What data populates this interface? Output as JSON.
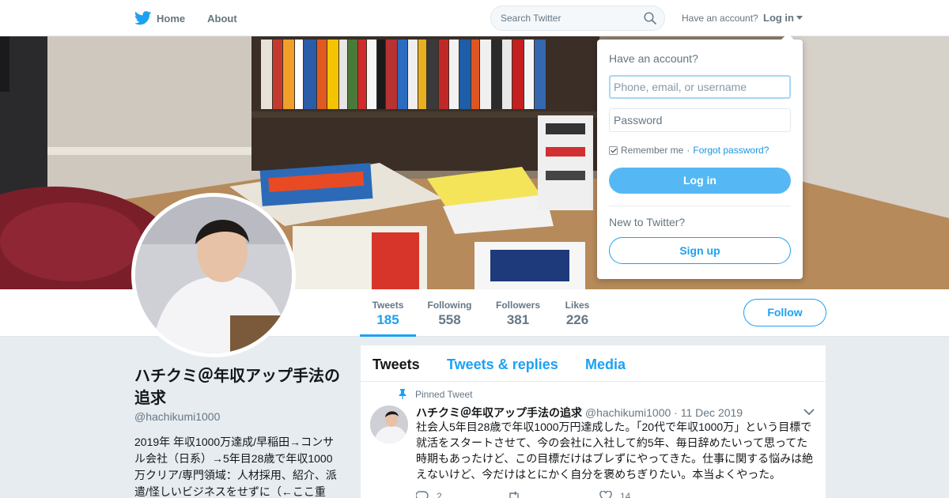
{
  "nav": {
    "home_label": "Home",
    "about_label": "About",
    "search_placeholder": "Search Twitter",
    "have_account": "Have an account?",
    "login_label": "Log in"
  },
  "profile": {
    "name": "ハチクミ＠年収アップ手法の追求",
    "handle": "@hachikumi1000",
    "bio": "2019年 年収1000万達成/早稲田→コンサル会社（日系）→5年目28歳で年収1000万クリア/専門領域：人材採用、紹介、派遣/怪しいビジネスをせずに（←ここ重",
    "follow_label": "Follow"
  },
  "stats": [
    {
      "label": "Tweets",
      "value": "185"
    },
    {
      "label": "Following",
      "value": "558"
    },
    {
      "label": "Followers",
      "value": "381"
    },
    {
      "label": "Likes",
      "value": "226"
    }
  ],
  "timeline": {
    "tabs": [
      "Tweets",
      "Tweets & replies",
      "Media"
    ],
    "pinned_label": "Pinned Tweet",
    "tweet": {
      "name": "ハチクミ＠年収アップ手法の追求",
      "handle": "@hachikumi1000",
      "date": "11 Dec 2019",
      "text": "社会人5年目28歳で年収1000万円達成した。「20代で年収1000万」という目標で就活をスタートさせて、今の会社に入社して約5年、毎日辞めたいって思ってた時期もあったけど、この目標だけはブレずにやってきた。仕事に関する悩みは絶えないけど、今だけはとにかく自分を褒めちぎりたい。本当よくやった。",
      "replies": "2",
      "retweets": "",
      "likes": "14"
    }
  },
  "login_dropdown": {
    "title": "Have an account?",
    "username_placeholder": "Phone, email, or username",
    "password_placeholder": "Password",
    "remember_label": "Remember me",
    "separator": "·",
    "forgot_label": "Forgot password?",
    "login_button": "Log in",
    "new_label": "New to Twitter?",
    "signup_button": "Sign up"
  },
  "colors": {
    "accent": "#1da1f2",
    "background": "#e6ecf0",
    "muted": "#657786"
  }
}
